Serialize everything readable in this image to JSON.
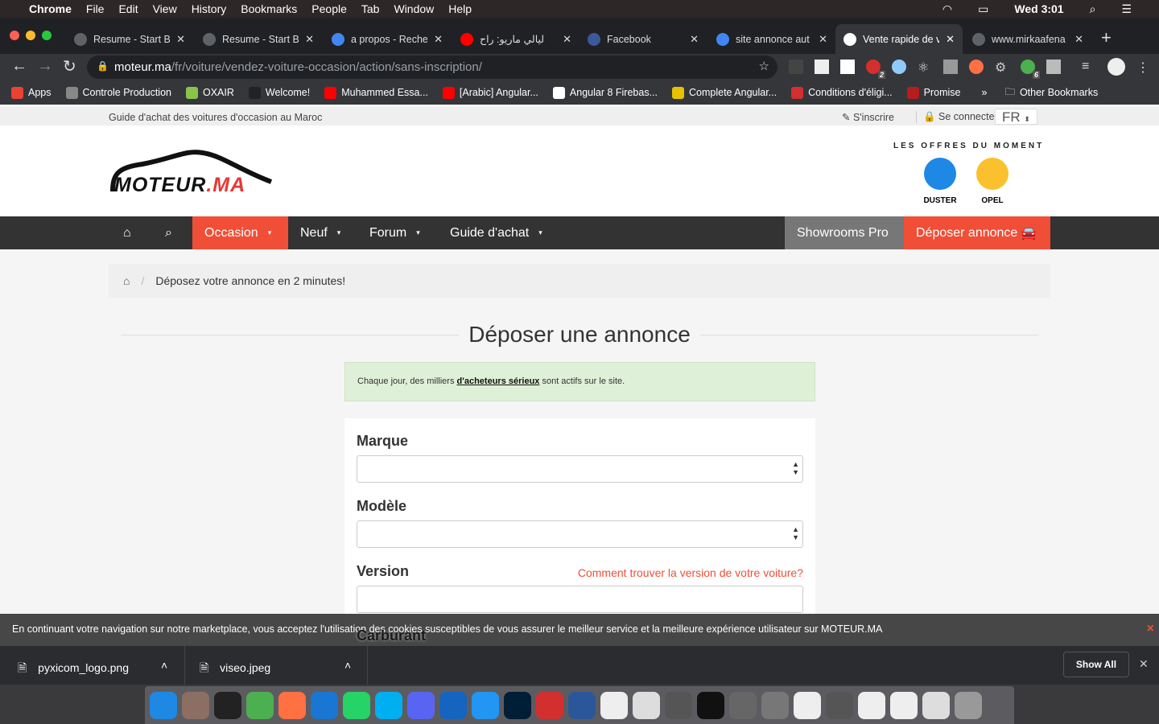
{
  "menubar": {
    "apple": "",
    "app": "Chrome",
    "items": [
      "File",
      "Edit",
      "View",
      "History",
      "Bookmarks",
      "People",
      "Tab",
      "Window",
      "Help"
    ],
    "clock": "Wed 3:01"
  },
  "tabs": [
    {
      "title": "Resume - Start B",
      "fav": "#5f6368"
    },
    {
      "title": "Resume - Start B",
      "fav": "#5f6368"
    },
    {
      "title": "a propos - Reche",
      "fav": "#4285f4"
    },
    {
      "title": "ليالي ماريو: راح",
      "fav": "#ff0000"
    },
    {
      "title": "Facebook",
      "fav": "#3b5998"
    },
    {
      "title": "site annonce aut",
      "fav": "#4285f4"
    },
    {
      "title": "Vente rapide de v",
      "fav": "#ffffff"
    },
    {
      "title": "www.mirkaafena",
      "fav": "#5f6368"
    }
  ],
  "new_tab": "+",
  "url": {
    "host": "moteur.ma",
    "path": "/fr/voiture/vendez-voiture-occasion/action/sans-inscription/"
  },
  "extension_badges": [
    "2",
    "6"
  ],
  "bookmarks": [
    {
      "label": "Apps",
      "color": "#e94235"
    },
    {
      "label": "Controle Production",
      "color": "#888"
    },
    {
      "label": "OXAIR",
      "color": "#8bc34a"
    },
    {
      "label": "Welcome!",
      "color": "#222"
    },
    {
      "label": "Muhammed Essa...",
      "color": "#ff0000"
    },
    {
      "label": "[Arabic] Angular...",
      "color": "#ff0000"
    },
    {
      "label": "Angular 8 Firebas...",
      "color": "#fff"
    },
    {
      "label": "Complete Angular...",
      "color": "#e6c200"
    },
    {
      "label": "Conditions d'éligi...",
      "color": "#d32f2f"
    },
    {
      "label": "Promise",
      "color": "#b71c1c"
    }
  ],
  "bookmarks_more": "»",
  "other_bookmarks": "Other Bookmarks",
  "site": {
    "tagline": "Guide d'achat des voitures d'occasion au Maroc",
    "signup": "S'inscrire",
    "login": "Se connecter",
    "lang": "FR",
    "logo_text": "MOTEUR.MA",
    "offers_title": "LES OFFRES DU MOMENT",
    "offers": [
      {
        "label": "DUSTER",
        "color": "#1e88e5"
      },
      {
        "label": "OPEL",
        "color": "#fbc02d"
      }
    ],
    "nav": {
      "occasion": "Occasion",
      "neuf": "Neuf",
      "forum": "Forum",
      "guide": "Guide d'achat",
      "showrooms": "Showrooms Pro",
      "deposer": "Déposer annonce"
    },
    "breadcrumb": "Déposez votre annonce en 2 minutes!",
    "page_title": "Déposer une annonce",
    "alert": {
      "before": "Chaque jour, des milliers ",
      "link": "d'acheteurs sérieux",
      "after": " sont actifs sur le site."
    },
    "form": {
      "marque": "Marque",
      "modele": "Modèle",
      "version": "Version",
      "version_help": "Comment trouver la version de votre voiture?",
      "carburant": "Carburant"
    },
    "accent": "#f04e37"
  },
  "cookie": {
    "text": "En continuant votre navigation sur notre marketplace, vous acceptez l'utilisation des cookies susceptibles de vous assurer le meilleur service et la meilleure expérience utilisateur sur MOTEUR.MA",
    "close": "×"
  },
  "downloads": {
    "files": [
      "pyxicom_logo.png",
      "viseo.jpeg"
    ],
    "show_all": "Show All",
    "close": "✕"
  }
}
